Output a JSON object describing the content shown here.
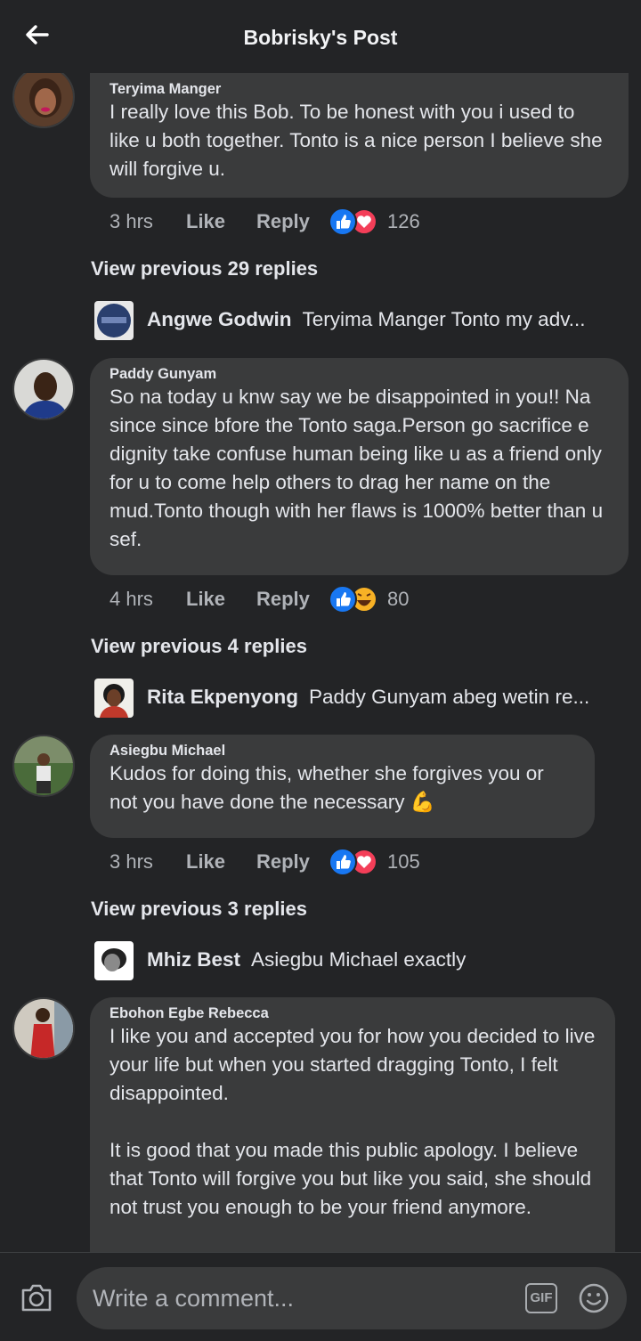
{
  "header": {
    "title": "Bobrisky's Post",
    "back_icon": "arrow-left-icon"
  },
  "comments": [
    {
      "author": "Teryima Manger",
      "text": "I really love this Bob. To be honest with you i used to like u both together. Tonto is a nice person I believe she will forgive u.",
      "time": "3 hrs",
      "like_label": "Like",
      "reply_label": "Reply",
      "reactions": [
        "like",
        "love"
      ],
      "reaction_count": "126",
      "view_previous": "View previous 29 replies",
      "reply": {
        "author": "Angwe Godwin",
        "text": "Teryima Manger Tonto my adv..."
      }
    },
    {
      "author": "Paddy Gunyam",
      "text": "So na today u knw say we be disappointed in you!! Na since since bfore the Tonto saga.Person go sacrifice e dignity take confuse  human being like u as a friend only for u to come help others to drag her name on the mud.Tonto though with her flaws is 1000% better than u sef.",
      "time": "4 hrs",
      "like_label": "Like",
      "reply_label": "Reply",
      "reactions": [
        "like",
        "haha"
      ],
      "reaction_count": "80",
      "view_previous": "View previous 4 replies",
      "reply": {
        "author": "Rita Ekpenyong",
        "text": "Paddy Gunyam abeg wetin re..."
      }
    },
    {
      "author": "Asiegbu Michael",
      "text": "Kudos for doing this, whether she forgives you or not you have done the necessary 💪",
      "time": "3 hrs",
      "like_label": "Like",
      "reply_label": "Reply",
      "reactions": [
        "like",
        "love"
      ],
      "reaction_count": "105",
      "view_previous": "View previous 3 replies",
      "reply": {
        "author": "Mhiz Best",
        "text": "Asiegbu Michael  exactly"
      }
    },
    {
      "author": "Ebohon Egbe Rebecca",
      "text": "I like you and accepted you for how you decided to live your life but when you started dragging Tonto, I felt disappointed.\n\nIt is good that you made this public apology. I believe that Tonto will forgive you but like you said, she should not trust you enough to be your friend anymore."
    }
  ],
  "composer": {
    "placeholder": "Write a comment...",
    "gif_label": "GIF",
    "camera_icon": "camera-icon",
    "emoji_icon": "smiley-icon"
  },
  "colors": {
    "background": "#232426",
    "bubble": "#3a3b3c",
    "like_blue": "#1877f2",
    "love_red": "#f33e58",
    "haha_yellow": "#f7b125"
  }
}
